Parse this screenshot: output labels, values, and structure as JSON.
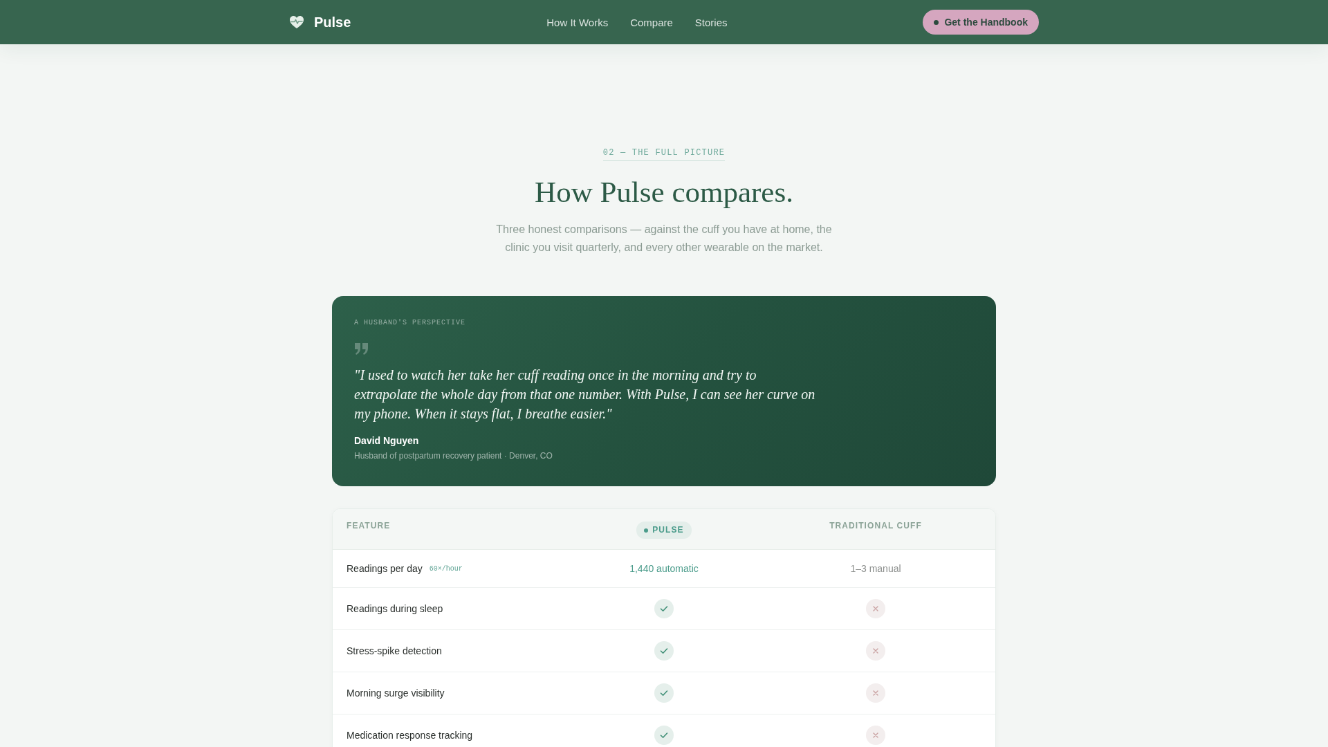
{
  "nav": {
    "brand": "Pulse",
    "links": [
      "How It Works",
      "Compare",
      "Stories"
    ],
    "cta": "Get the Handbook"
  },
  "section": {
    "eyebrow": "02 — THE FULL PICTURE",
    "title": "How Pulse compares.",
    "intro": "Three honest comparisons — against the cuff you have at home, the clinic you visit quarterly, and every other wearable on the market."
  },
  "testimonial": {
    "label": "A HUSBAND'S PERSPECTIVE",
    "quote": "\"I used to watch her take her cuff reading once in the morning and try to extrapolate the whole day from that one number. With Pulse, I can see her curve on my phone. When it stays flat, I breathe easier.\"",
    "name": "David Nguyen",
    "detail": "Husband of postpartum recovery patient · Denver, CO"
  },
  "table": {
    "columns": [
      {
        "label": "FEATURE",
        "highlighted": false
      },
      {
        "label": "PULSE",
        "highlighted": true
      },
      {
        "label": "TRADITIONAL CUFF",
        "highlighted": false
      }
    ],
    "rows": [
      {
        "cells": [
          {
            "kind": "feature",
            "text": "Readings per day",
            "note": "60×/hour"
          },
          {
            "kind": "text",
            "text": "1,440 automatic"
          },
          {
            "kind": "text",
            "text": "1–3 manual"
          }
        ]
      },
      {
        "cells": [
          {
            "kind": "feature",
            "text": "Readings during sleep"
          },
          {
            "kind": "support",
            "supported": true
          },
          {
            "kind": "support",
            "supported": false
          }
        ]
      },
      {
        "cells": [
          {
            "kind": "feature",
            "text": "Stress-spike detection"
          },
          {
            "kind": "support",
            "supported": true
          },
          {
            "kind": "support",
            "supported": false
          }
        ]
      },
      {
        "cells": [
          {
            "kind": "feature",
            "text": "Morning surge visibility"
          },
          {
            "kind": "support",
            "supported": true
          },
          {
            "kind": "support",
            "supported": false
          }
        ]
      },
      {
        "cells": [
          {
            "kind": "feature",
            "text": "Medication response tracking"
          },
          {
            "kind": "support",
            "supported": true
          },
          {
            "kind": "support",
            "supported": false
          }
        ]
      }
    ]
  }
}
